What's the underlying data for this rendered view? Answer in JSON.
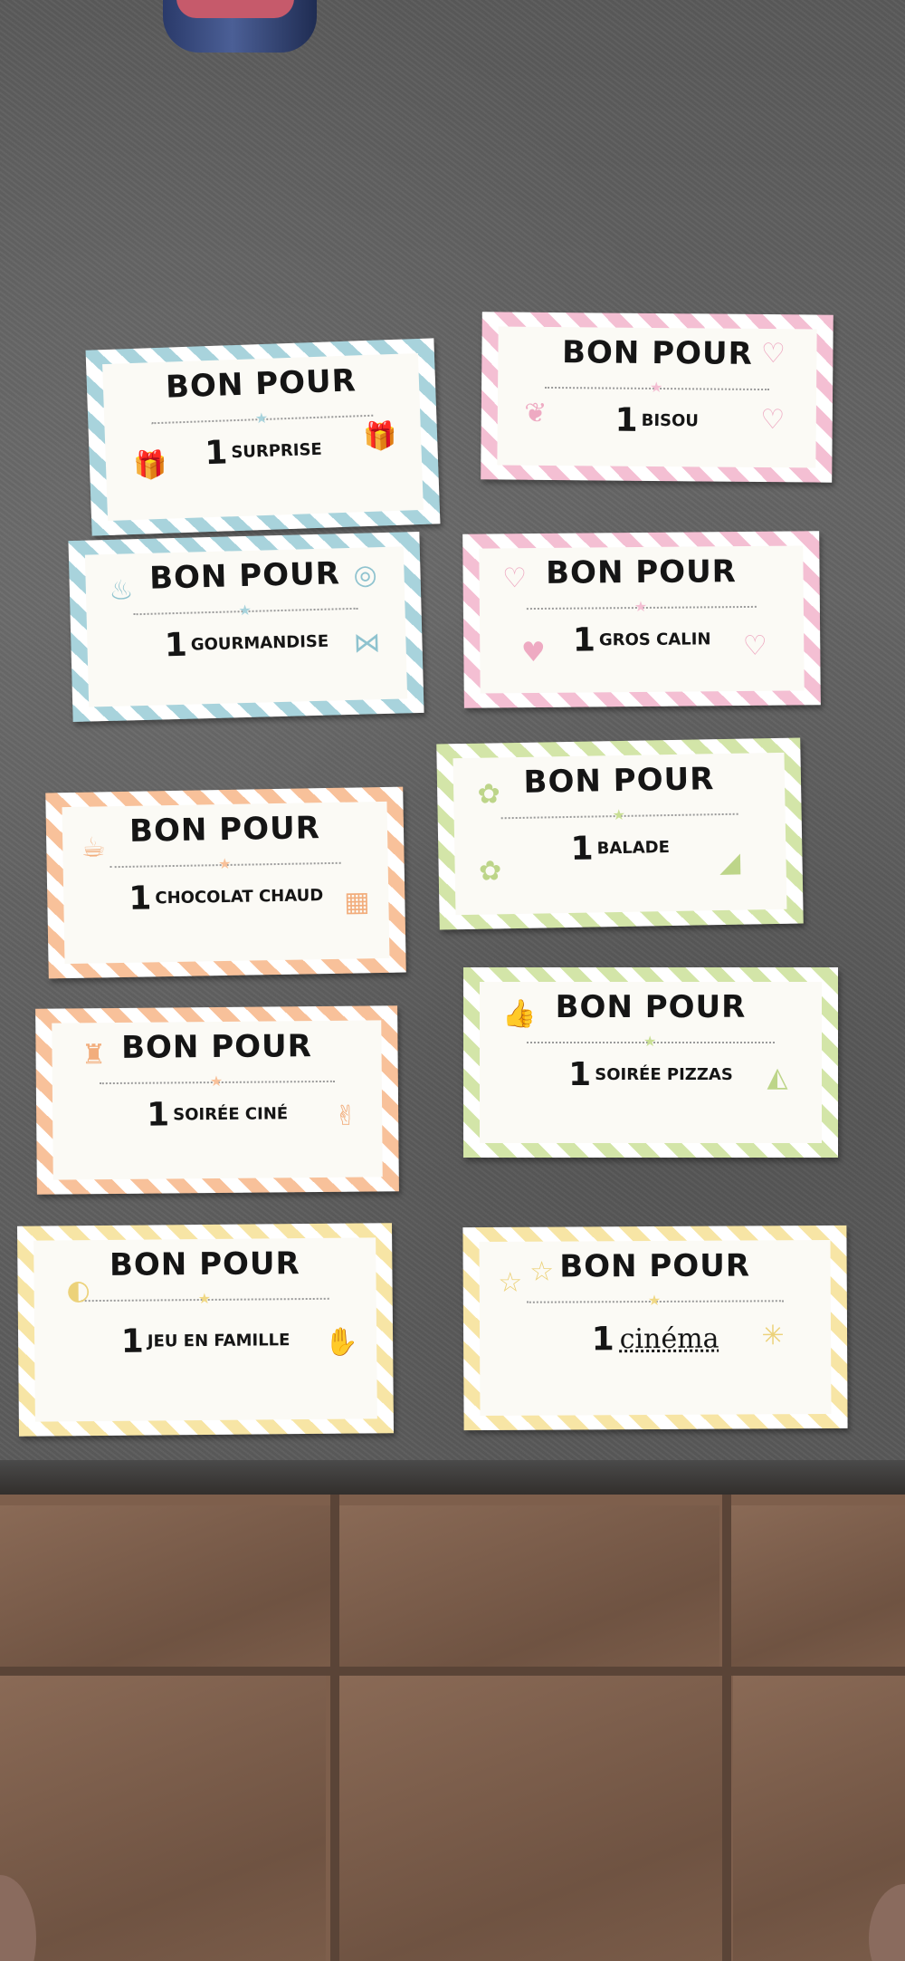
{
  "photo": {
    "subject": "Bons pour coupons",
    "background_colors": {
      "counter": "#5e5e5e",
      "floor": "#7e5f4c"
    }
  },
  "cards": [
    {
      "title": "BON POUR",
      "number": "1",
      "item": "SURPRISE",
      "theme": "blue",
      "icons": [
        "gift-icon",
        "gift-icon"
      ]
    },
    {
      "title": "BON POUR",
      "number": "1",
      "item": "BISOU",
      "theme": "pink",
      "icons": [
        "heart-icon",
        "lips-icon",
        "heart-icon"
      ]
    },
    {
      "title": "BON POUR",
      "number": "1",
      "item": "GOURMANDISE",
      "theme": "blue",
      "icons": [
        "cupcake-icon",
        "lollipop-icon",
        "candy-icon"
      ]
    },
    {
      "title": "BON POUR",
      "number": "1",
      "item": "GROS CALIN",
      "theme": "pink",
      "icons": [
        "heart-icon",
        "heart-icon",
        "heart-icon"
      ]
    },
    {
      "title": "BON POUR",
      "number": "1",
      "item": "CHOCOLAT CHAUD",
      "theme": "orange",
      "icons": [
        "mug-icon",
        "chocolate-bar-icon"
      ]
    },
    {
      "title": "BON POUR",
      "number": "1",
      "item": "BALADE",
      "theme": "green",
      "icons": [
        "flower-icon",
        "flower-icon",
        "shoe-icon"
      ]
    },
    {
      "title": "BON POUR",
      "number": "1",
      "item": "SOIRÉE CINÉ",
      "theme": "orange",
      "icons": [
        "popcorn-icon",
        "bunny-icon"
      ]
    },
    {
      "title": "BON POUR",
      "number": "1",
      "item": "SOIRÉE PIZZAS",
      "theme": "green",
      "icons": [
        "thumbs-up-icon",
        "pizza-icon"
      ]
    },
    {
      "title": "BON POUR",
      "number": "1",
      "item": "JEU EN FAMILLE",
      "theme": "yellow",
      "icons": [
        "ball-icon",
        "hand-icon"
      ]
    },
    {
      "title": "BON POUR",
      "number": "1",
      "item": "cinéma",
      "theme": "yellow",
      "handwritten": true,
      "icons": [
        "star-icon",
        "star-icon",
        "sparkle-icon"
      ]
    }
  ],
  "theme_colors": {
    "blue": "#a8d3dc",
    "pink": "#f4bfd3",
    "orange": "#f8c19a",
    "green": "#d3e5a8",
    "yellow": "#f7e5a5"
  }
}
